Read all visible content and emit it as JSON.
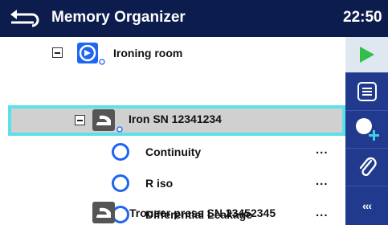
{
  "header": {
    "title": "Memory Organizer",
    "time": "22:50"
  },
  "tree": {
    "location": {
      "label": "Ironing room",
      "icon": "location-icon"
    },
    "appliance": {
      "label": "Iron SN 12341234",
      "icon": "iron-icon",
      "selected": true
    },
    "tests": [
      {
        "label": "Continuity",
        "status": "..."
      },
      {
        "label": "R iso",
        "status": "..."
      },
      {
        "label": "Differential Leakage",
        "status": "..."
      }
    ],
    "next_appliance": {
      "label": "Trouser press SN 23452345",
      "icon": "iron-icon"
    }
  },
  "sidebar": {
    "buttons": [
      {
        "name": "start-test-button",
        "icon": "play-icon"
      },
      {
        "name": "view-results-button",
        "icon": "list-icon"
      },
      {
        "name": "add-test-button",
        "icon": "add-circle-icon"
      },
      {
        "name": "attach-button",
        "icon": "paperclip-icon"
      },
      {
        "name": "more-button",
        "icon": "more-icon",
        "label": "‹‹‹"
      }
    ]
  },
  "colors": {
    "header_bg": "#0c1c4d",
    "sidebar_bg": "#223a8e",
    "selection_border": "#5de0ea",
    "selection_bg": "#d0d0d0",
    "accent_blue": "#1f66ee",
    "play_green": "#2fbf4a"
  }
}
